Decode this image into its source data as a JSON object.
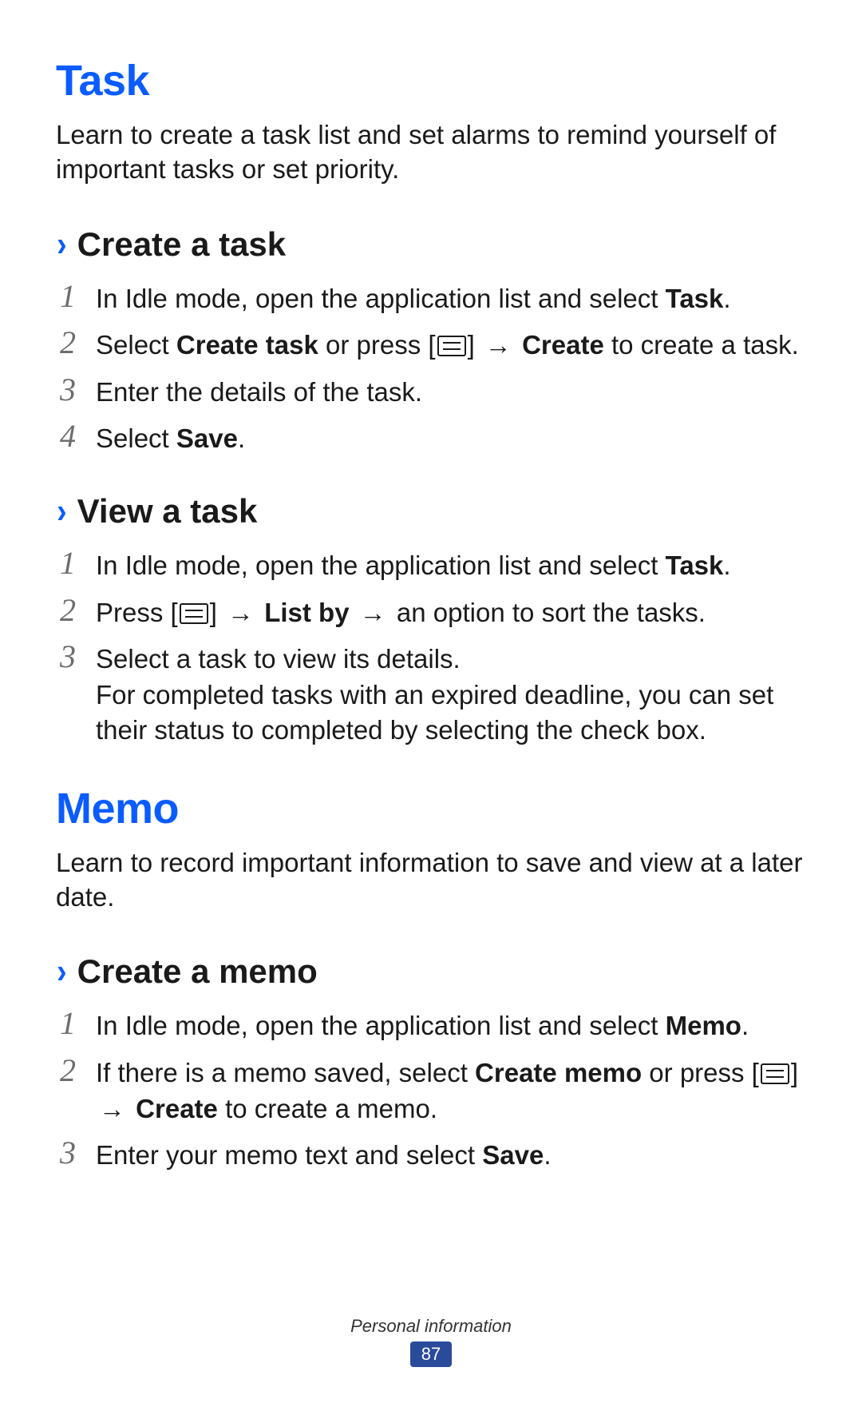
{
  "task": {
    "heading": "Task",
    "intro": "Learn to create a task list and set alarms to remind yourself of important tasks or set priority.",
    "create": {
      "heading": "Create a task",
      "step1_a": "In Idle mode, open the application list and select ",
      "step1_b": "Task",
      "step1_c": ".",
      "step2_a": "Select ",
      "step2_b": "Create task",
      "step2_c": " or press [",
      "step2_d": "] ",
      "step2_arrow": "→",
      "step2_e": " ",
      "step2_f": "Create",
      "step2_g": " to create a task.",
      "step3": "Enter the details of the task.",
      "step4_a": "Select ",
      "step4_b": "Save",
      "step4_c": "."
    },
    "view": {
      "heading": "View a task",
      "step1_a": "In Idle mode, open the application list and select ",
      "step1_b": "Task",
      "step1_c": ".",
      "step2_a": "Press [",
      "step2_b": "] ",
      "step2_arrow1": "→",
      "step2_c": " ",
      "step2_d": "List by",
      "step2_e": " ",
      "step2_arrow2": "→",
      "step2_f": " an option to sort the tasks.",
      "step3": "Select a task to view its details.",
      "step3_extra": "For completed tasks with an expired deadline, you can set their status to completed by selecting the check box."
    }
  },
  "memo": {
    "heading": "Memo",
    "intro": "Learn to record important information to save and view at a later date.",
    "create": {
      "heading": "Create a memo",
      "step1_a": "In Idle mode, open the application list and select ",
      "step1_b": "Memo",
      "step1_c": ".",
      "step2_a": "If there is a memo saved, select ",
      "step2_b": "Create memo",
      "step2_c": " or press [",
      "step2_d": "] ",
      "step2_arrow": "→",
      "step2_e": " ",
      "step2_f": "Create",
      "step2_g": " to create a memo.",
      "step3_a": "Enter your memo text and select ",
      "step3_b": "Save",
      "step3_c": "."
    }
  },
  "footer": {
    "section": "Personal information",
    "page": "87"
  },
  "nums": {
    "n1": "1",
    "n2": "2",
    "n3": "3",
    "n4": "4"
  }
}
